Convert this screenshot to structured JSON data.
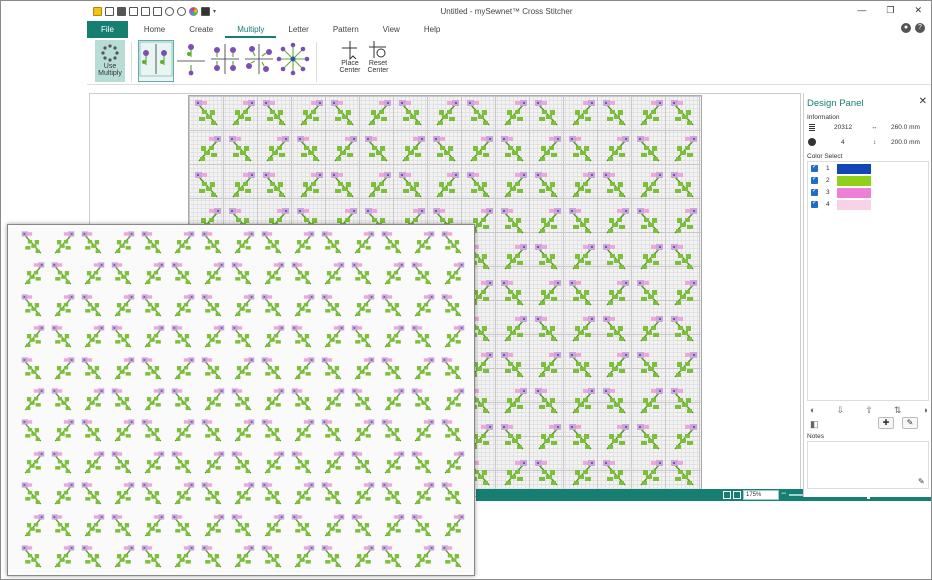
{
  "window": {
    "title": "Untitled - mySewnet™ Cross Stitcher",
    "minimize_glyph": "—",
    "restore_glyph": "❐",
    "close_glyph": "✕"
  },
  "tabs": [
    {
      "label": "File"
    },
    {
      "label": "Home"
    },
    {
      "label": "Create"
    },
    {
      "label": "Multiply"
    },
    {
      "label": "Letter"
    },
    {
      "label": "Pattern"
    },
    {
      "label": "View"
    },
    {
      "label": "Help"
    }
  ],
  "ribbon": {
    "use_multiply_line1": "Use",
    "use_multiply_line2": "Multiply",
    "place_center_line1": "Place",
    "place_center_line2": "Center",
    "reset_center_line1": "Reset",
    "reset_center_line2": "Center"
  },
  "design_panel": {
    "title": "Design Panel",
    "close": "✕",
    "information_label": "Information",
    "stitch_count": "20312",
    "width": "260.0 mm",
    "color_count": "4",
    "height": "200.0 mm",
    "color_select_label": "Color Select",
    "notes_label": "Notes",
    "colors": [
      {
        "num": "1",
        "hex": "#1246b4"
      },
      {
        "num": "2",
        "hex": "#8ed01a"
      },
      {
        "num": "3",
        "hex": "#ee7fd6"
      },
      {
        "num": "4",
        "hex": "#f9d2e8"
      }
    ]
  },
  "status": {
    "zoom": "175%",
    "zoom_minus": "−",
    "zoom_plus": "+",
    "zoom_level": 0.58
  },
  "motif_colors": {
    "leaf": "#7cbf3a",
    "leaf_dark": "#4f9a1f",
    "flower": "#c9a7d9",
    "flower_pink": "#f0a6dd",
    "purple": "#7d4fb4"
  }
}
